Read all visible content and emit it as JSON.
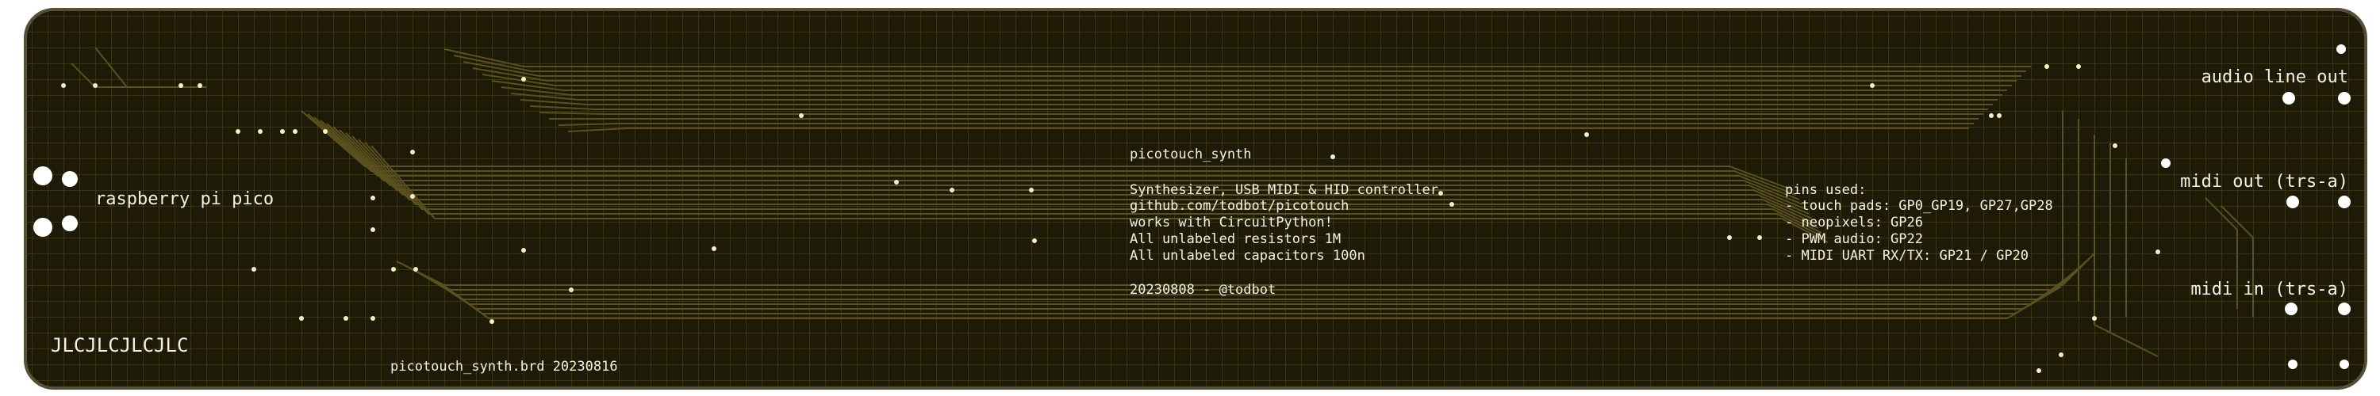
{
  "board": {
    "colors": {
      "background": "#ffffff",
      "board_fill": "#1d1b07",
      "board_edge": "#54503a",
      "grid": "#4a4318",
      "trace": "#5a5020",
      "silkscreen": "#f4f1e6",
      "pad": "#ffffff"
    },
    "labels": {
      "raspberry_pi_pico": "raspberry pi pico",
      "jlc": "JLCJLCJLCJLC",
      "board_file": "picotouch_synth.brd 20230816",
      "audio_line_out": "audio line out",
      "midi_out": "midi out (trs-a)",
      "midi_in": "midi in (trs-a)"
    },
    "info_block": {
      "title": "picotouch_synth",
      "description": "Synthesizer, USB MIDI & HID controller",
      "url": "github.com/todbot/picotouch",
      "circuitpython": "works with CircuitPython!",
      "resistors": "All unlabeled resistors 1M",
      "capacitors": "All unlabeled capacitors 100n",
      "date_author": "20230808 - @todbot"
    },
    "pins": {
      "header": "pins used:",
      "touch_pads": "- touch pads: GP0_GP19, GP27,GP28",
      "neopixels": "- neopixels: GP26",
      "pwm_audio": "- PWM audio: GP22",
      "midi_uart": "- MIDI UART RX/TX: GP21 / GP20"
    }
  }
}
